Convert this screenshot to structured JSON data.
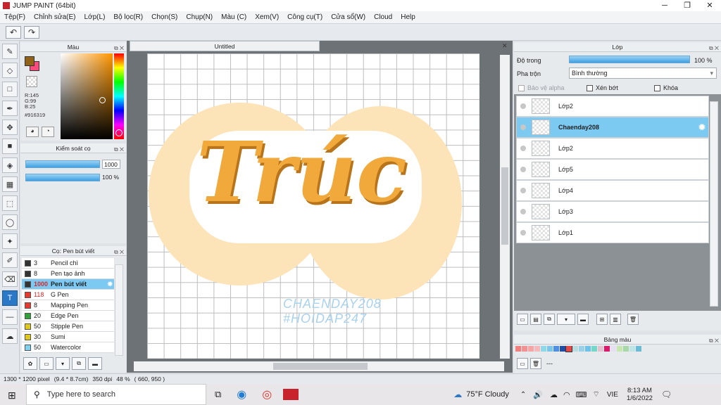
{
  "app": {
    "title": "JUMP PAINT (64bit)"
  },
  "menu": [
    "Tệp(F)",
    "Chỉnh sửa(E)",
    "Lớp(L)",
    "Bộ lọc(R)",
    "Chọn(S)",
    "Chụp(N)",
    "Màu (C)",
    "Xem(V)",
    "Công cụ(T)",
    "Cửa sổ(W)",
    "Cloud",
    "Help"
  ],
  "color_panel": {
    "title": "Màu",
    "r": "R:145",
    "g": "G:99",
    "b": "B:25",
    "hex": "#916319"
  },
  "brush_ctrl": {
    "title": "Kiểm soát cọ",
    "size": "1000",
    "opacity": "100 %"
  },
  "brush_list": {
    "title": "Cọ: Pen bút viết",
    "items": [
      {
        "size": "3",
        "name": "Pencil chì",
        "color": "#333333"
      },
      {
        "size": "8",
        "name": "Pen tạo ảnh",
        "color": "#333333"
      },
      {
        "size": "1000",
        "name": "Pen bút viết",
        "color": "#333333"
      },
      {
        "size": "118",
        "name": "G Pen",
        "color": "#e8392f"
      },
      {
        "size": "8",
        "name": "Mapping Pen",
        "color": "#e8392f"
      },
      {
        "size": "20",
        "name": "Edge Pen",
        "color": "#2fa33a"
      },
      {
        "size": "50",
        "name": "Stipple Pen",
        "color": "#e0c81a"
      },
      {
        "size": "30",
        "name": "Sumi",
        "color": "#e0c81a"
      },
      {
        "size": "50",
        "name": "Watercolor",
        "color": "#7fd1f0"
      }
    ]
  },
  "canvas": {
    "tab": "Untitled",
    "art_text": "Trúc",
    "watermark1": "CHAENDAY208",
    "watermark2": "#HOIDAP247"
  },
  "layer_panel": {
    "title": "Lớp",
    "opacity_label": "Độ trong",
    "opacity_value": "100 %",
    "blend_label": "Pha trộn",
    "blend_value": "Bình thường",
    "protect_alpha": "Bảo vệ alpha",
    "clip": "Xén bớt",
    "lock": "Khóa",
    "layers": [
      {
        "name": "Lớp2"
      },
      {
        "name": "Chaenday208"
      },
      {
        "name": "Lớp2"
      },
      {
        "name": "Lớp5"
      },
      {
        "name": "Lớp4"
      },
      {
        "name": "Lớp3"
      },
      {
        "name": "Lớp1"
      }
    ]
  },
  "palette": {
    "title": "Bảng màu",
    "dash": "---",
    "colors": [
      "#f08080",
      "#f49090",
      "#f4a6a6",
      "#f6b8b8",
      "#8fd8e8",
      "#7ac6ee",
      "#4f8ee0",
      "#1f4ea8",
      "#e24a4a",
      "#b9dbe0",
      "#9ad0e8",
      "#6ec1e8",
      "#76d6c8",
      "#e8c1d0",
      "#d81b6a",
      "#e6e0f0",
      "#c8e6b0",
      "#a8d8a8",
      "#c0e4e6",
      "#6bbad8"
    ]
  },
  "status": {
    "size": "1300 * 1200 pixel",
    "cm": "(9.4 * 8.7cm)",
    "dpi": "350 dpi",
    "zoom": "48 %",
    "coords": "( 660, 950 )"
  },
  "taskbar": {
    "search_placeholder": "Type here to search",
    "weather": "75°F Cloudy",
    "lang": "VIE",
    "time": "8:13 AM",
    "date": "1/6/2022"
  }
}
